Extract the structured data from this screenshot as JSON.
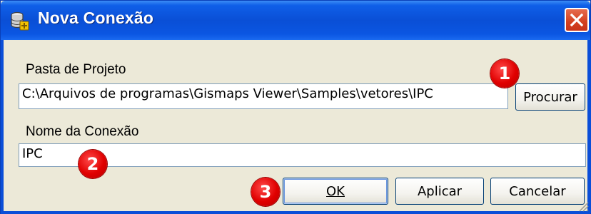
{
  "window": {
    "title": "Nova Conexão",
    "icon": "database-add-icon",
    "close_icon": "close-icon"
  },
  "project_folder": {
    "label": "Pasta de Projeto",
    "value": "C:\\Arquivos de programas\\Gismaps Viewer\\Samples\\vetores\\IPC",
    "browse_button": "Procurar"
  },
  "connection_name": {
    "label": "Nome da Conexão",
    "value": "IPC"
  },
  "buttons": {
    "ok": "OK",
    "apply": "Aplicar",
    "cancel": "Cancelar"
  },
  "annotations": [
    "1",
    "2",
    "3"
  ],
  "colors": {
    "titlebar": "#0a4fd6",
    "dialog_bg": "#ece9d8",
    "badge": "#e00000",
    "close": "#d4401f"
  }
}
